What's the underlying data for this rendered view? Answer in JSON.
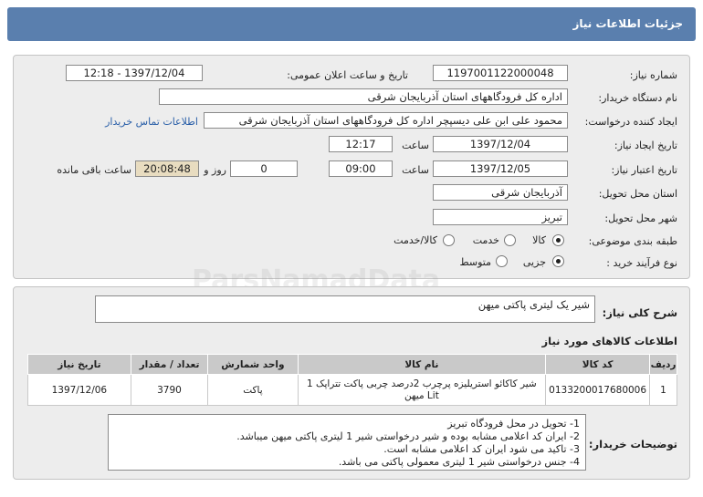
{
  "header": {
    "title": "جزئیات اطلاعات نیاز"
  },
  "form": {
    "need_number_label": "شماره نیاز:",
    "need_number": "1197001122000048",
    "announce_label": "تاریخ و ساعت اعلان عمومی:",
    "announce_value": "1397/12/04 - 12:18",
    "buyer_org_label": "نام دستگاه خریدار:",
    "buyer_org": "اداره کل فرودگاههای استان آذربایجان شرقی",
    "requester_label": "ایجاد کننده درخواست:",
    "requester": "محمود علی ابن علی دیسپچر اداره کل فرودگاههای استان آذربایجان شرقی",
    "contact_link": "اطلاعات تماس خریدار",
    "created_label": "تاریخ ایجاد نیاز:",
    "created_date": "1397/12/04",
    "time_label": "ساعت",
    "created_time": "12:17",
    "valid_label": "تاریخ اعتبار نیاز:",
    "valid_date": "1397/12/05",
    "valid_time": "09:00",
    "days_label": "روز و",
    "days": "0",
    "remaining_time": "20:08:48",
    "remaining_label": "ساعت باقی مانده",
    "province_label": "استان محل تحویل:",
    "province": "آذربایجان شرقی",
    "city_label": "شهر محل تحویل:",
    "city": "تبریز",
    "category_label": "طبقه بندی موضوعی:",
    "category_options": [
      "کالا",
      "خدمت",
      "کالا/خدمت"
    ],
    "process_label": "نوع فرآیند خرید :",
    "process_options": [
      "جزیی",
      "متوسط"
    ]
  },
  "summary": {
    "label": "شرح کلی نیاز:",
    "value": "شیر یک لیتری پاکتی میهن"
  },
  "goods": {
    "title": "اطلاعات کالاهای مورد نیاز",
    "columns": [
      "ردیف",
      "کد کالا",
      "نام کالا",
      "واحد شمارش",
      "تعداد / مقدار",
      "تاریخ نیاز"
    ],
    "rows": [
      [
        "1",
        "0133200017680006",
        "شیر کاکائو استریلیزه پرچرب 2درصد چربی پاکت تتراپک 1 Lit میهن",
        "پاکت",
        "3790",
        "1397/12/06"
      ]
    ]
  },
  "notes": {
    "label": "توضیحات خریدار:",
    "lines": [
      "1- تحویل در محل فرودگاه تبریز",
      "2- ایران کد اعلامی مشابه بوده و شیر درخواستی شیر 1 لیتری پاکتی میهن میباشد.",
      "3- تاکید می شود ایران کد اعلامی مشابه است.",
      "4- جنس درخواستی شیر 1 لیتری معمولی پاکتی می باشد."
    ]
  },
  "watermark": "ParsNamadData"
}
